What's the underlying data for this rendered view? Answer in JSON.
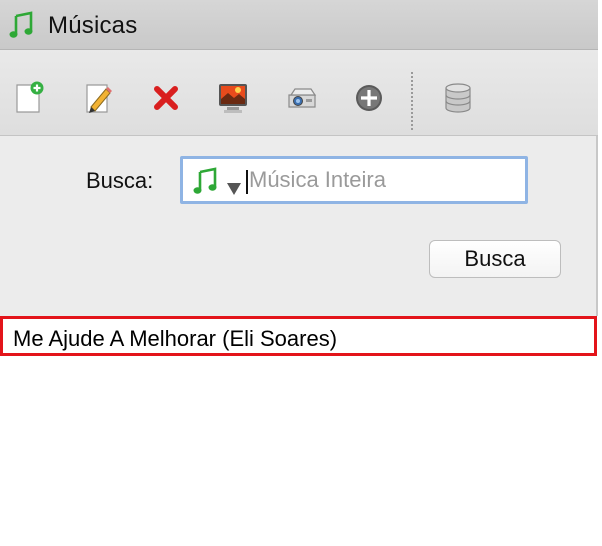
{
  "window": {
    "title": "Músicas",
    "title_icon": "music-note-icon"
  },
  "toolbar": {
    "items": [
      {
        "name": "new-document-button",
        "icon": "new-document-icon"
      },
      {
        "name": "edit-button",
        "icon": "pencil-icon"
      },
      {
        "name": "delete-button",
        "icon": "red-x-icon"
      },
      {
        "name": "projector-slide-button",
        "icon": "monitor-image-icon"
      },
      {
        "name": "projector-button",
        "icon": "projector-icon"
      },
      {
        "name": "add-button",
        "icon": "plus-circle-icon"
      },
      {
        "name": "database-button",
        "icon": "database-icon"
      }
    ]
  },
  "search": {
    "label": "Busca:",
    "placeholder": "Música Inteira",
    "value": "",
    "scope_icon": "music-note-icon",
    "button_label": "Busca"
  },
  "results": [
    {
      "text": "Me Ajude A Melhorar (Eli Soares)",
      "selected": true
    }
  ],
  "colors": {
    "selection_border": "#e3141a",
    "field_focus": "#8fb4e4",
    "note_green": "#2ea836"
  }
}
